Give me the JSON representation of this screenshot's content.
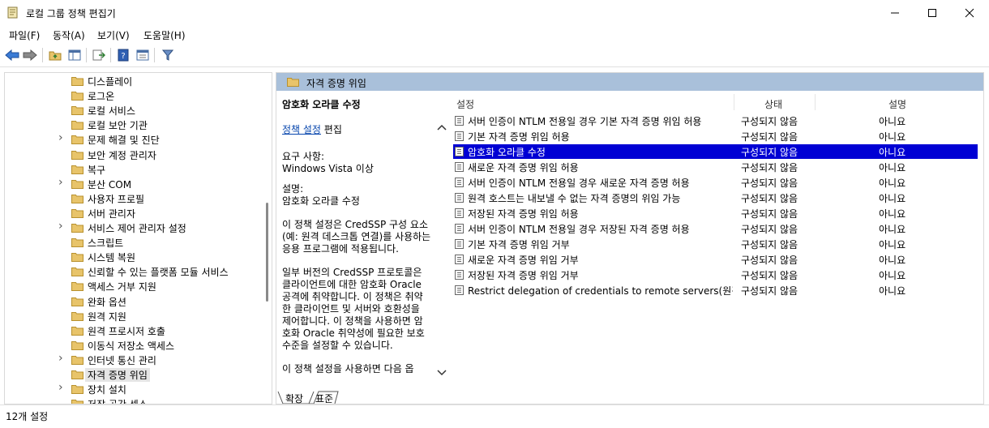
{
  "window": {
    "title": "로컬 그룹 정책 편집기"
  },
  "menu": {
    "items": [
      "파일(F)",
      "동작(A)",
      "보기(V)",
      "도움말(H)"
    ]
  },
  "tree": {
    "items": [
      {
        "label": "디스플레이",
        "expandable": false
      },
      {
        "label": "로그온",
        "expandable": false
      },
      {
        "label": "로컬 서비스",
        "expandable": false
      },
      {
        "label": "로컬 보안 기관",
        "expandable": false
      },
      {
        "label": "문제 해결 및 진단",
        "expandable": true
      },
      {
        "label": "보안 계정 관리자",
        "expandable": false
      },
      {
        "label": "복구",
        "expandable": false
      },
      {
        "label": "분산 COM",
        "expandable": true
      },
      {
        "label": "사용자 프로필",
        "expandable": false
      },
      {
        "label": "서버 관리자",
        "expandable": false
      },
      {
        "label": "서비스 제어 관리자 설정",
        "expandable": true
      },
      {
        "label": "스크립트",
        "expandable": false
      },
      {
        "label": "시스템 복원",
        "expandable": false
      },
      {
        "label": "신뢰할 수 있는 플랫폼 모듈 서비스",
        "expandable": false
      },
      {
        "label": "액세스 거부 지원",
        "expandable": false
      },
      {
        "label": "완화 옵션",
        "expandable": false
      },
      {
        "label": "원격 지원",
        "expandable": false
      },
      {
        "label": "원격 프로시저 호출",
        "expandable": false
      },
      {
        "label": "이동식 저장소 액세스",
        "expandable": false
      },
      {
        "label": "인터넷 통신 관리",
        "expandable": true
      },
      {
        "label": "자격 증명 위임",
        "expandable": false,
        "selected": true
      },
      {
        "label": "장치 설치",
        "expandable": true
      },
      {
        "label": "저장 공간 센스",
        "expandable": false
      }
    ]
  },
  "header": {
    "title": "자격 증명 위임"
  },
  "description": {
    "title": "암호화 오라클 수정",
    "edit_link": "정책 설정",
    "edit_suffix": " 편집",
    "req_label": "요구 사항:",
    "req_value": "Windows Vista 이상",
    "desc_label": "설명:",
    "desc_value": "암호화 오라클 수정",
    "para1": "이 정책 설정은 CredSSP 구성 요소(예: 원격 데스크톱 연결)를 사용하는 응용 프로그램에 적용됩니다.",
    "para2": "일부 버전의 CredSSP 프로토콜은 클라이언트에 대한 암호화 Oracle 공격에 취약합니다.  이 정책은 취약한 클라이언트 및 서버와 호환성을 제어합니다.  이 정책을 사용하면 암호화 Oracle 취약성에 필요한 보호 수준을 설정할 수 있습니다.",
    "para3": "이 정책 설정을 사용하면 다음 옵"
  },
  "tabs": {
    "extended": "확장",
    "standard": "표준"
  },
  "list": {
    "columns": {
      "setting": "설정",
      "state": "상태",
      "comment": "설명"
    },
    "rows": [
      {
        "name": "서버 인증이 NTLM 전용일 경우 기본 자격 증명 위임 허용",
        "state": "구성되지 않음",
        "comment": "아니요"
      },
      {
        "name": "기본 자격 증명 위임 허용",
        "state": "구성되지 않음",
        "comment": "아니요"
      },
      {
        "name": "암호화 오라클 수정",
        "state": "구성되지 않음",
        "comment": "아니요",
        "selected": true
      },
      {
        "name": "새로운 자격 증명 위임 허용",
        "state": "구성되지 않음",
        "comment": "아니요"
      },
      {
        "name": "서버 인증이 NTLM 전용일 경우 새로운 자격 증명 허용",
        "state": "구성되지 않음",
        "comment": "아니요"
      },
      {
        "name": "원격 호스트는 내보낼 수 없는 자격 증명의 위임 가능",
        "state": "구성되지 않음",
        "comment": "아니요"
      },
      {
        "name": "저장된 자격 증명 위임 허용",
        "state": "구성되지 않음",
        "comment": "아니요"
      },
      {
        "name": "서버 인증이 NTLM 전용일 경우 저장된 자격 증명 허용",
        "state": "구성되지 않음",
        "comment": "아니요"
      },
      {
        "name": "기본 자격 증명 위임 거부",
        "state": "구성되지 않음",
        "comment": "아니요"
      },
      {
        "name": "새로운 자격 증명 위임 거부",
        "state": "구성되지 않음",
        "comment": "아니요"
      },
      {
        "name": "저장된 자격 증명 위임 거부",
        "state": "구성되지 않음",
        "comment": "아니요"
      },
      {
        "name": "Restrict delegation of credentials to remote servers(원격 서...",
        "state": "구성되지 않음",
        "comment": "아니요"
      }
    ]
  },
  "status": {
    "text": "12개 설정"
  },
  "colors": {
    "selection": "#0000d4",
    "header_band": "#a9c0da",
    "folder": "#e8c46a"
  }
}
